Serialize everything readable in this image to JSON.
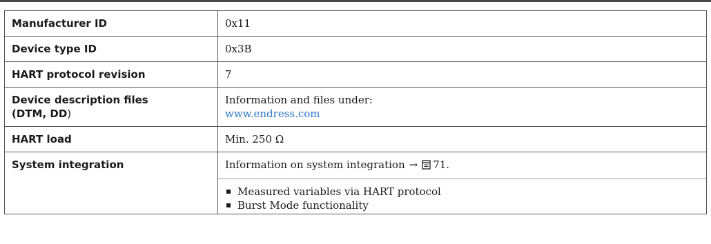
{
  "rows": [
    {
      "label": "Manufacturer ID",
      "value": "0x11"
    },
    {
      "label": "Device type ID",
      "value": "0x3B"
    },
    {
      "label": "HART protocol revision",
      "value": "7"
    },
    {
      "label_line1": "Device description files",
      "label_line2_a": "(DTM, DD",
      "label_line2_b": ")",
      "value_line1": "Information and files under:",
      "link": "www.endress.com"
    },
    {
      "label": "HART load",
      "value": "Min. 250 Ω"
    },
    {
      "label": "System integration",
      "value_text": "Information on system integration",
      "arrow": "→",
      "page_ref": "71.",
      "bullets": [
        "Measured variables via HART protocol",
        "Burst Mode functionality"
      ]
    }
  ],
  "icons": {
    "page_reference": "document-page-icon"
  }
}
